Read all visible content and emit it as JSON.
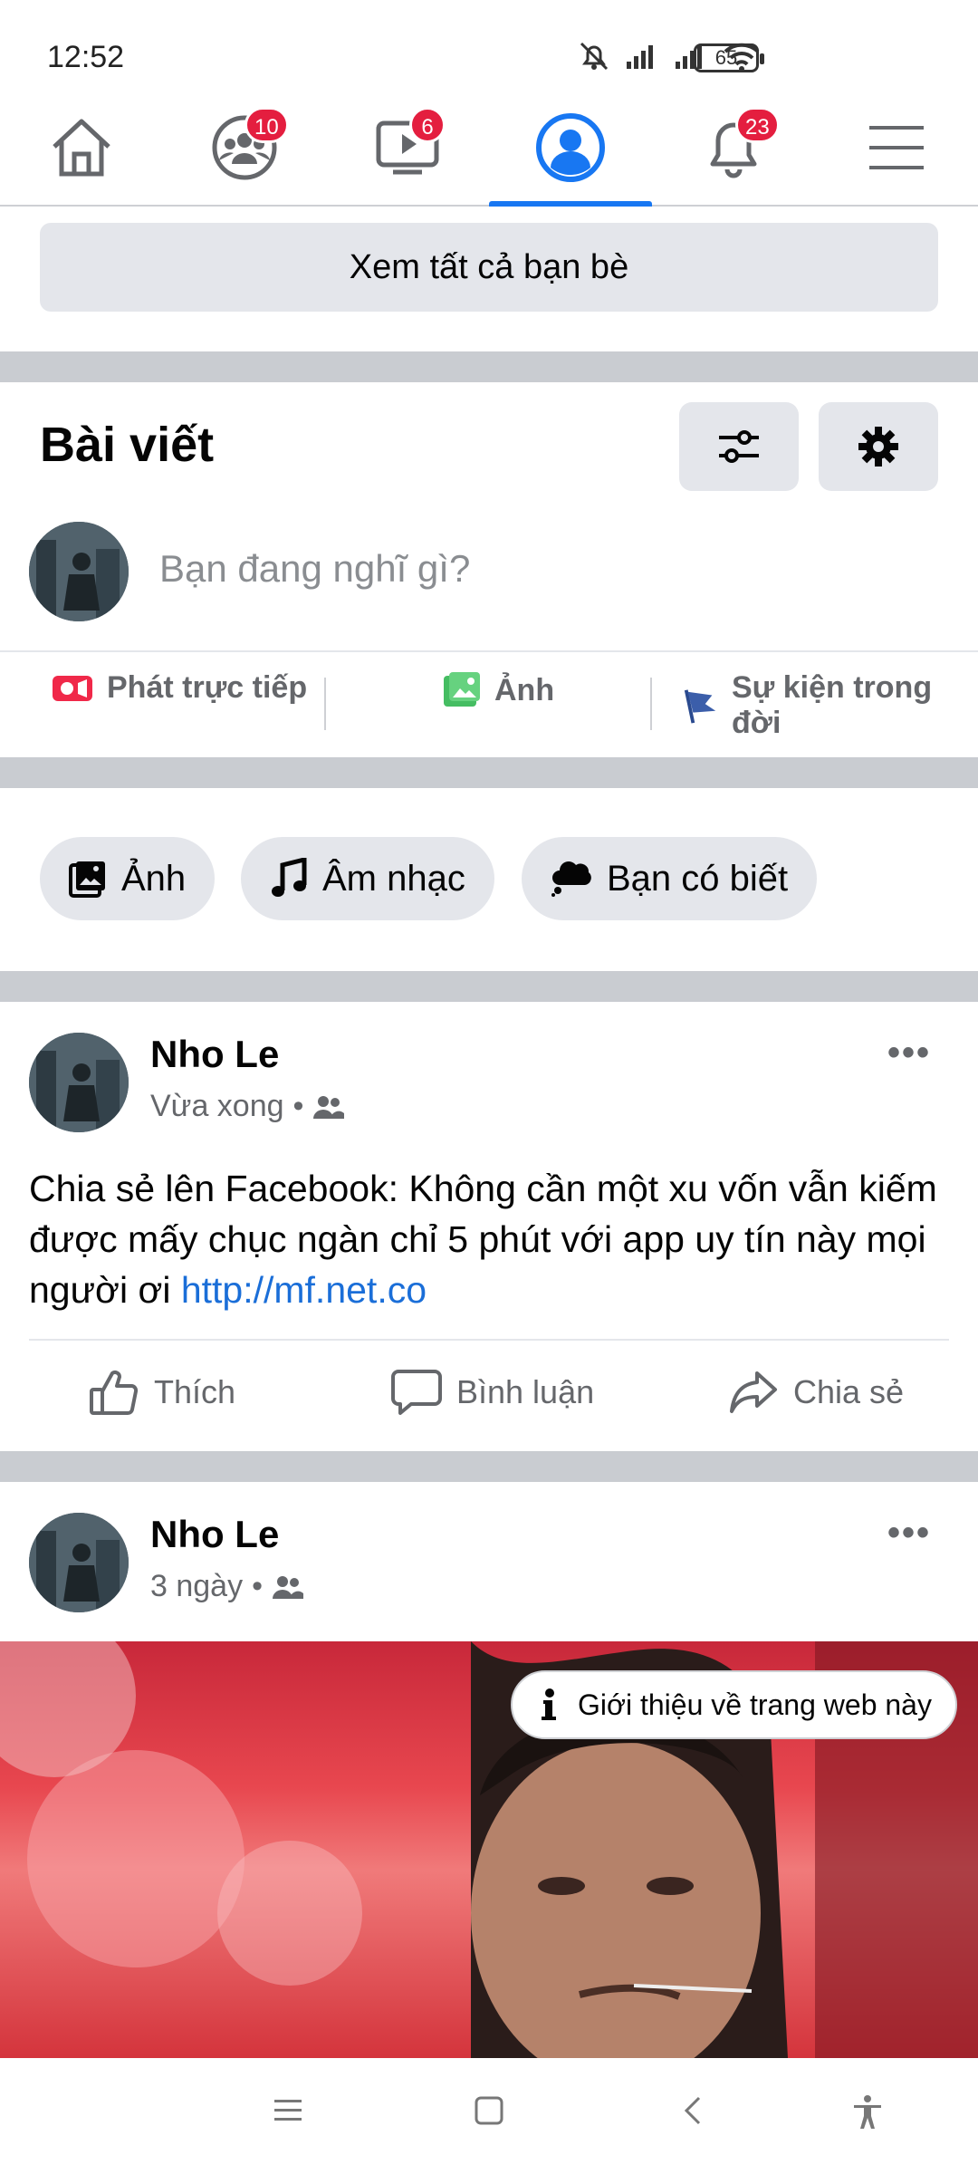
{
  "status_bar": {
    "time": "12:52",
    "battery": "65"
  },
  "top_nav": {
    "tabs": [
      {
        "name": "home",
        "badge": ""
      },
      {
        "name": "groups",
        "badge": "10"
      },
      {
        "name": "watch",
        "badge": "6"
      },
      {
        "name": "profile",
        "badge": ""
      },
      {
        "name": "notifications",
        "badge": "23"
      },
      {
        "name": "menu",
        "badge": ""
      }
    ],
    "active_tab": "profile",
    "accent": "#1877f2"
  },
  "friends": {
    "see_all_label": "Xem tất cả bạn bè"
  },
  "posts_section": {
    "title": "Bài viết",
    "composer_placeholder": "Bạn đang nghĩ gì?",
    "actions": {
      "live": "Phát trực tiếp",
      "photo": "Ảnh",
      "life_event": "Sự kiện trong đời"
    },
    "chips": {
      "photo": "Ảnh",
      "music": "Âm nhạc",
      "did_you_know": "Bạn có biết"
    }
  },
  "posts": [
    {
      "author": "Nho Le",
      "time": "Vừa xong",
      "separator": "•",
      "text": "Chia sẻ lên Facebook: Không cần một xu vốn vẫn kiếm được mấy chục ngàn chỉ 5 phút với app uy tín này mọi người ơi ",
      "link": "http://mf.net.co",
      "like": "Thích",
      "comment": "Bình luận",
      "share": "Chia sẻ"
    },
    {
      "author": "Nho Le",
      "time": "3 ngày",
      "separator": "•",
      "info_pill": "Giới thiệu về trang web này"
    }
  ]
}
